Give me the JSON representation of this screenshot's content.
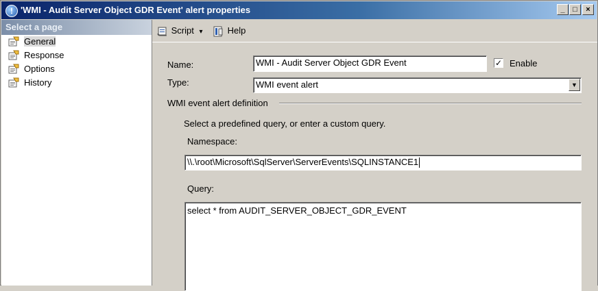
{
  "window": {
    "title": "'WMI - Audit Server Object GDR Event' alert properties",
    "controls": {
      "minimize": "_",
      "maximize": "□",
      "close": "×"
    }
  },
  "sidebar": {
    "header": "Select a page",
    "items": [
      {
        "label": "General",
        "selected": true
      },
      {
        "label": "Response",
        "selected": false
      },
      {
        "label": "Options",
        "selected": false
      },
      {
        "label": "History",
        "selected": false
      }
    ]
  },
  "toolbar": {
    "script_label": "Script",
    "script_arrow": "▾",
    "help_label": "Help"
  },
  "form": {
    "name_label": "Name:",
    "name_value": "WMI - Audit Server Object GDR Event",
    "enable_label": "Enable",
    "enable_checked": "✓",
    "type_label": "Type:",
    "type_value": "WMI event alert",
    "type_arrow": "▼",
    "group_label": "WMI event alert definition",
    "instruction": "Select a predefined query, or enter a custom query.",
    "namespace_label": "Namespace:",
    "namespace_value": "\\\\.\\root\\Microsoft\\SqlServer\\ServerEvents\\SQLINSTANCE1",
    "query_label": "Query:",
    "query_value": "select * from AUDIT_SERVER_OBJECT_GDR_EVENT"
  },
  "colors": {
    "titlebar_start": "#0a246a",
    "titlebar_end": "#a6caf0",
    "dialog_face": "#d4d0c8"
  }
}
